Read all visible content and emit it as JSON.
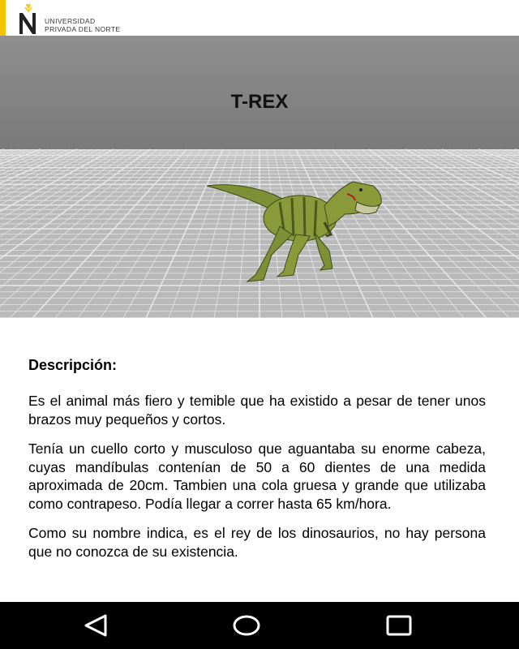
{
  "header": {
    "logo_line1": "UNIVERSIDAD",
    "logo_line2": "PRIVADA DEL NORTE",
    "accent_color": "#f5c400"
  },
  "viewer": {
    "title": "T-REX",
    "model": "tyrannosaurus-3d-model"
  },
  "description": {
    "heading": "Descripción:",
    "paragraphs": [
      "Es el animal más fiero y temible que ha existido a pesar de tener unos brazos muy pequeños y cortos.",
      "Tenía un cuello corto y musculoso que  aguantaba su enorme cabeza, cuyas mandíbulas contenían de 50 a 60 dientes de una medida aproximada de 20cm. Tambien una cola gruesa y grande que utilizaba como contrapeso. Podía llegar a correr hasta 65 km/hora.",
      "Como su nombre indica, es el rey de los dinosaurios, no hay persona que no conozca de su existencia."
    ]
  },
  "navbar": {
    "back_icon": "back-triangle-icon",
    "home_icon": "home-circle-icon",
    "recents_icon": "recents-square-icon"
  }
}
